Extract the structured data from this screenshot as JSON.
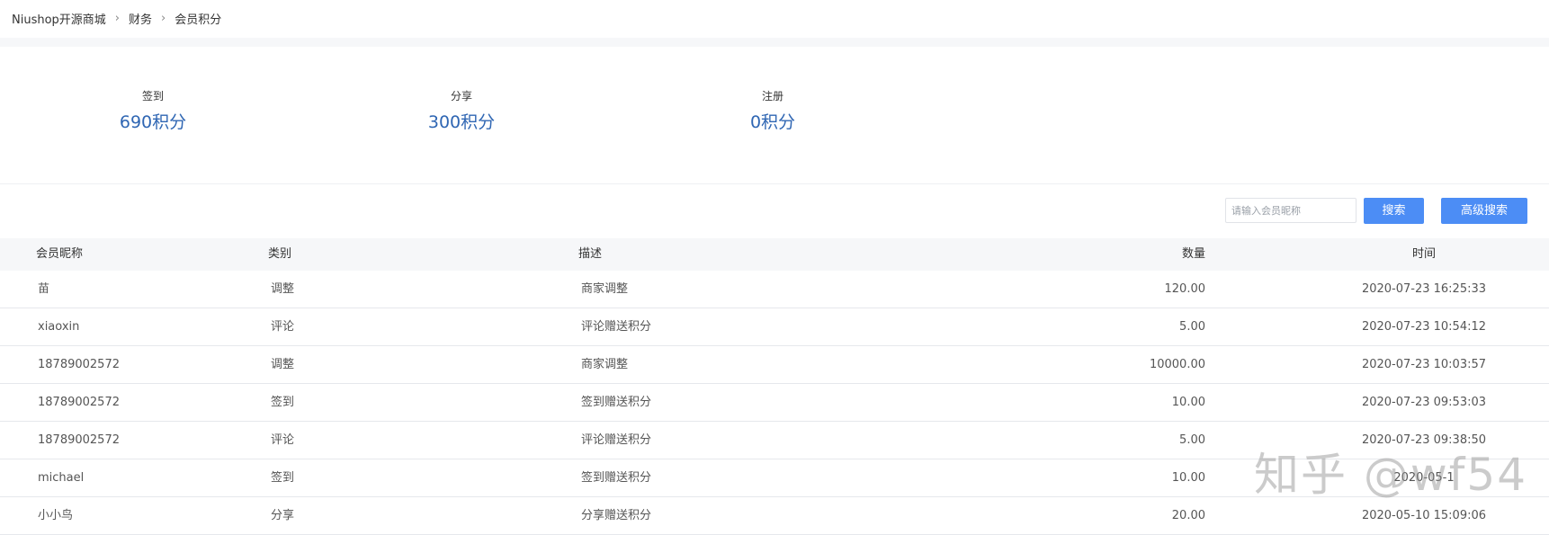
{
  "breadcrumb": [
    "Niushop开源商城",
    "财务",
    "会员积分"
  ],
  "stats": [
    {
      "label": "签到",
      "value": "690积分"
    },
    {
      "label": "分享",
      "value": "300积分"
    },
    {
      "label": "注册",
      "value": "0积分"
    }
  ],
  "search": {
    "placeholder": "请输入会员昵称",
    "button_label": "搜索",
    "advanced_label": "高级搜索"
  },
  "table": {
    "headers": {
      "name": "会员昵称",
      "type": "类别",
      "desc": "描述",
      "qty": "数量",
      "time": "时间"
    },
    "rows": [
      {
        "name": "苗",
        "type": "调整",
        "desc": "商家调整",
        "qty": "120.00",
        "time": "2020-07-23 16:25:33"
      },
      {
        "name": "xiaoxin",
        "type": "评论",
        "desc": "评论赠送积分",
        "qty": "5.00",
        "time": "2020-07-23 10:54:12"
      },
      {
        "name": "18789002572",
        "type": "调整",
        "desc": "商家调整",
        "qty": "10000.00",
        "time": "2020-07-23 10:03:57"
      },
      {
        "name": "18789002572",
        "type": "签到",
        "desc": "签到赠送积分",
        "qty": "10.00",
        "time": "2020-07-23 09:53:03"
      },
      {
        "name": "18789002572",
        "type": "评论",
        "desc": "评论赠送积分",
        "qty": "5.00",
        "time": "2020-07-23 09:38:50"
      },
      {
        "name": "michael",
        "type": "签到",
        "desc": "签到赠送积分",
        "qty": "10.00",
        "time": "2020-05-1"
      },
      {
        "name": "小小鸟",
        "type": "分享",
        "desc": "分享赠送积分",
        "qty": "20.00",
        "time": "2020-05-10 15:09:06"
      }
    ]
  },
  "watermark": "知乎 @wf54",
  "colors": {
    "accent": "#4c8df5",
    "stat_value": "#2f66b3",
    "band": "#f6f7f9"
  }
}
